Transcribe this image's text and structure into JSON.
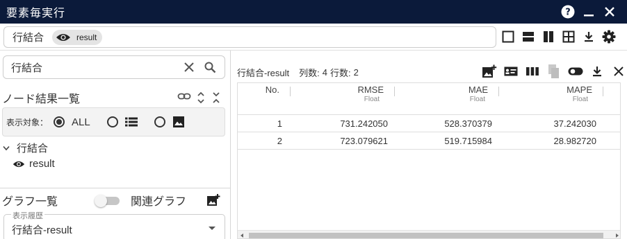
{
  "window": {
    "title": "要素毎実行"
  },
  "breadcrumb": {
    "label": "行結合",
    "chip": "result"
  },
  "search": {
    "value": "行結合"
  },
  "node_list": {
    "title": "ノード結果一覧",
    "filter_label": "表示対象：",
    "filter_all": "ALL",
    "tree_parent": "行結合",
    "tree_child": "result"
  },
  "graph_list": {
    "title": "グラフ一覧",
    "toggle_label": "関連グラフ",
    "history_legend": "表示履歴",
    "history_value": "行結合-result"
  },
  "result": {
    "title": "行結合-result",
    "cols_label": "列数:",
    "cols_value": "4",
    "rows_label": "行数:",
    "rows_value": "2",
    "columns": [
      {
        "name": "No.",
        "type": ""
      },
      {
        "name": "RMSE",
        "type": "Float"
      },
      {
        "name": "MAE",
        "type": "Float"
      },
      {
        "name": "MAPE",
        "type": "Float"
      }
    ],
    "rows": [
      [
        "1",
        "731.242050",
        "528.370379",
        "37.242030"
      ],
      [
        "2",
        "723.079621",
        "519.715984",
        "28.982720"
      ]
    ]
  },
  "icons": {
    "help": "help-circle-icon",
    "minimize": "minimize-icon",
    "close": "close-icon",
    "eye": "eye-icon",
    "clear": "clear-icon",
    "search": "search-icon",
    "link": "link-icon",
    "expand": "expand-all-icon",
    "collapse": "collapse-all-icon",
    "list": "list-icon",
    "image": "image-icon",
    "add_graph": "add-graph-icon",
    "settings": "gear-icon",
    "download": "download-icon"
  },
  "colors": {
    "titlebar": "#0b1a3a",
    "chip": "#e4e4e4",
    "icon": "#222222"
  }
}
